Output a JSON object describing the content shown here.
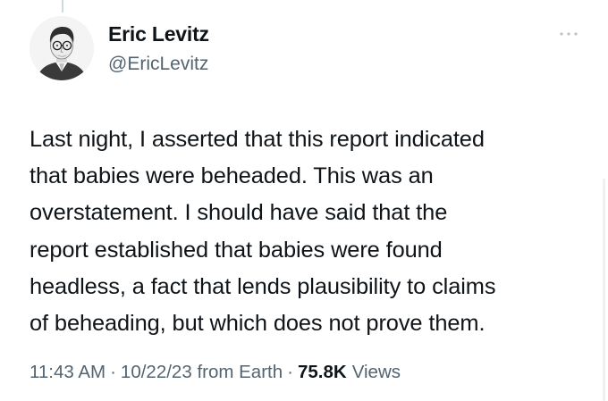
{
  "tweet": {
    "author": {
      "name": "Eric Levitz",
      "handle": "@EricLevitz"
    },
    "more_icon": "more-horizontal-icon",
    "text_lines": [
      "Last night, I asserted that this report indicated",
      "that babies were beheaded. This was an",
      "overstatement. I should have said that the",
      "report established that babies were found",
      "headless, a fact that lends plausibility to claims",
      "of beheading, but which does not prove them."
    ],
    "time": "11:43 AM",
    "separator": "·",
    "date": "10/22/23",
    "source": "from Earth",
    "views_count": "75.8K",
    "views_label": "Views"
  }
}
